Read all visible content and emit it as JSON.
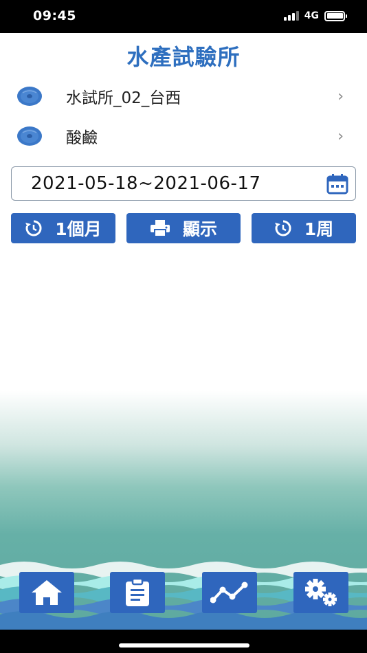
{
  "status_bar": {
    "time": "09:45",
    "network": "4G"
  },
  "header": {
    "title": "水產試驗所"
  },
  "list": {
    "site_label": "水試所_02_台西",
    "parameter_label": "酸鹼",
    "chevron": "›"
  },
  "date_range": {
    "value": "2021-05-18~2021-06-17"
  },
  "buttons": {
    "month_label": "1個月",
    "show_label": "顯示",
    "week_label": "1周"
  },
  "bottom_nav": {
    "items": [
      "home-icon",
      "clipboard-icon",
      "line-chart-icon",
      "gears-icon"
    ]
  },
  "colors": {
    "accent": "#2f66bd",
    "title": "#2e6fbf",
    "sea": "#5ea99f"
  }
}
